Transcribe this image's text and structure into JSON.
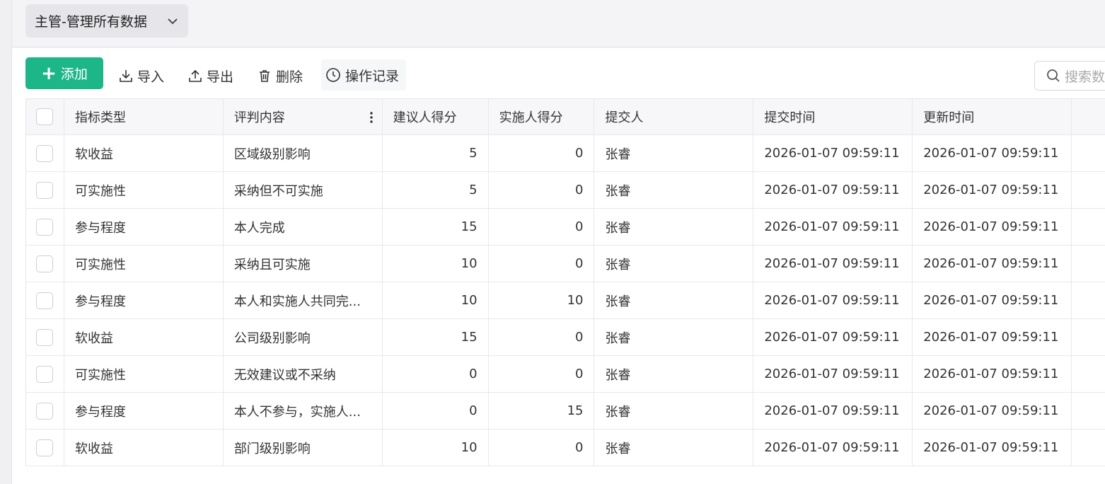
{
  "view_select": {
    "label": "主管-管理所有数据"
  },
  "toolbar": {
    "add_label": "添加",
    "import_label": "导入",
    "export_label": "导出",
    "delete_label": "删除",
    "history_label": "操作记录"
  },
  "search": {
    "placeholder": "搜索数"
  },
  "table": {
    "columns": [
      "指标类型",
      "评判内容",
      "建议人得分",
      "实施人得分",
      "提交人",
      "提交时间",
      "更新时间"
    ],
    "rows": [
      {
        "type": "软收益",
        "content": "区域级别影响",
        "sugg": "5",
        "impl": "0",
        "submitter": "张睿",
        "stime": "2026-01-07 09:59:11",
        "utime": "2026-01-07 09:59:11"
      },
      {
        "type": "可实施性",
        "content": "采纳但不可实施",
        "sugg": "5",
        "impl": "0",
        "submitter": "张睿",
        "stime": "2026-01-07 09:59:11",
        "utime": "2026-01-07 09:59:11"
      },
      {
        "type": "参与程度",
        "content": "本人完成",
        "sugg": "15",
        "impl": "0",
        "submitter": "张睿",
        "stime": "2026-01-07 09:59:11",
        "utime": "2026-01-07 09:59:11"
      },
      {
        "type": "可实施性",
        "content": "采纳且可实施",
        "sugg": "10",
        "impl": "0",
        "submitter": "张睿",
        "stime": "2026-01-07 09:59:11",
        "utime": "2026-01-07 09:59:11"
      },
      {
        "type": "参与程度",
        "content": "本人和实施人共同完...",
        "sugg": "10",
        "impl": "10",
        "submitter": "张睿",
        "stime": "2026-01-07 09:59:11",
        "utime": "2026-01-07 09:59:11"
      },
      {
        "type": "软收益",
        "content": "公司级别影响",
        "sugg": "15",
        "impl": "0",
        "submitter": "张睿",
        "stime": "2026-01-07 09:59:11",
        "utime": "2026-01-07 09:59:11"
      },
      {
        "type": "可实施性",
        "content": "无效建议或不采纳",
        "sugg": "0",
        "impl": "0",
        "submitter": "张睿",
        "stime": "2026-01-07 09:59:11",
        "utime": "2026-01-07 09:59:11"
      },
      {
        "type": "参与程度",
        "content": "本人不参与，实施人...",
        "sugg": "0",
        "impl": "15",
        "submitter": "张睿",
        "stime": "2026-01-07 09:59:11",
        "utime": "2026-01-07 09:59:11"
      },
      {
        "type": "软收益",
        "content": "部门级别影响",
        "sugg": "10",
        "impl": "0",
        "submitter": "张睿",
        "stime": "2026-01-07 09:59:11",
        "utime": "2026-01-07 09:59:11"
      }
    ]
  },
  "colors": {
    "accent": "#1db688",
    "header_bg": "#f7f7f9",
    "border": "#e8e8ec"
  },
  "icons": {
    "view": "chevron-down-icon",
    "add": "plus-icon",
    "import": "download-icon",
    "export": "upload-icon",
    "delete": "trash-icon",
    "history": "clock-icon",
    "search": "search-icon",
    "column_menu": "more-vertical-icon"
  }
}
